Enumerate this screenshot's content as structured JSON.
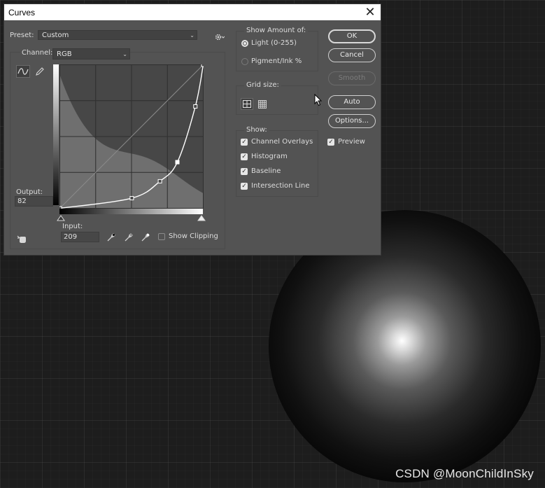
{
  "dialog": {
    "title": "Curves",
    "close_glyph": "✕",
    "preset_label": "Preset:",
    "preset_value": "Custom",
    "channel_label": "Channel:",
    "channel_value": "RGB",
    "output_label": "Output:",
    "output_value": "82",
    "input_label": "Input:",
    "input_value": "209",
    "show_clipping_label": "Show Clipping",
    "show_clipping_checked": false
  },
  "show_amount": {
    "title": "Show Amount of:",
    "options": [
      {
        "label": "Light  (0-255)",
        "selected": true
      },
      {
        "label": "Pigment/Ink %",
        "selected": false
      }
    ]
  },
  "grid_size": {
    "title": "Grid size:"
  },
  "show": {
    "title": "Show:",
    "items": [
      {
        "label": "Channel Overlays",
        "checked": true
      },
      {
        "label": "Histogram",
        "checked": true
      },
      {
        "label": "Baseline",
        "checked": true
      },
      {
        "label": "Intersection Line",
        "checked": true
      }
    ]
  },
  "buttons": {
    "ok": "OK",
    "cancel": "Cancel",
    "smooth": "Smooth",
    "auto": "Auto",
    "options": "Options..."
  },
  "preview": {
    "label": "Preview",
    "checked": true
  },
  "curve_points": [
    {
      "input": 0,
      "output": 0
    },
    {
      "input": 128,
      "output": 18
    },
    {
      "input": 178,
      "output": 48
    },
    {
      "input": 209,
      "output": 82
    },
    {
      "input": 241,
      "output": 181
    },
    {
      "input": 255,
      "output": 255
    }
  ],
  "watermark": "CSDN @MoonChildInSky",
  "colors": {
    "dialog_bg": "#535353",
    "canvas_bg": "#1d1d1d",
    "graph_bg": "#474747",
    "histogram": "#6f6f6f",
    "curve": "#ffffff"
  }
}
